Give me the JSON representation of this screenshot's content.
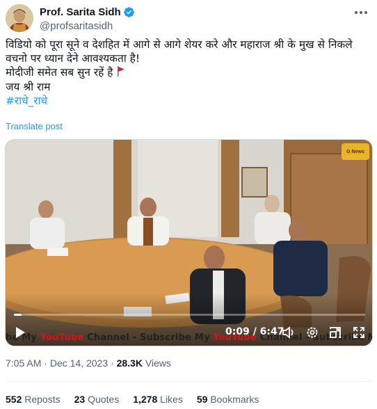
{
  "author": {
    "display_name": "Prof. Sarita Sidh",
    "handle": "@profsaritasidh",
    "verified_icon": "verified-badge-icon",
    "avatar": "avatar"
  },
  "tweet": {
    "lines": [
      "विडियो को पूरा सूने व देशहित में आगे से आगे शेयर करे और महाराज श्री के मुख से निकले",
      "वचनो पर ध्यान देने आवश्यकता है!",
      "मोदीजी समेत सब सुन रहें है",
      "जय श्री राम"
    ],
    "hashtag": "#राधे_राधे",
    "translate_label": "Translate post"
  },
  "video": {
    "time": "0:09 / 6:47",
    "progress": 0.022,
    "banner_parts": [
      "be My ",
      "YouTube",
      " Channel  -  Subscribe My ",
      "YouTube",
      " Channel  -  Subscribe My"
    ],
    "logo_text": "G News"
  },
  "meta": {
    "time": "7:05 AM",
    "separator": "·",
    "date": "Dec 14, 2023",
    "views_count": "28.3K",
    "views_label": "Views"
  },
  "stats": {
    "reposts_count": "552",
    "reposts_label": "Reposts",
    "quotes_count": "23",
    "quotes_label": "Quotes",
    "likes_count": "1,278",
    "likes_label": "Likes",
    "bookmarks_count": "59",
    "bookmarks_label": "Bookmarks"
  },
  "colors": {
    "accent": "#1d9bf0",
    "text": "#0f1419",
    "muted": "#536471"
  }
}
